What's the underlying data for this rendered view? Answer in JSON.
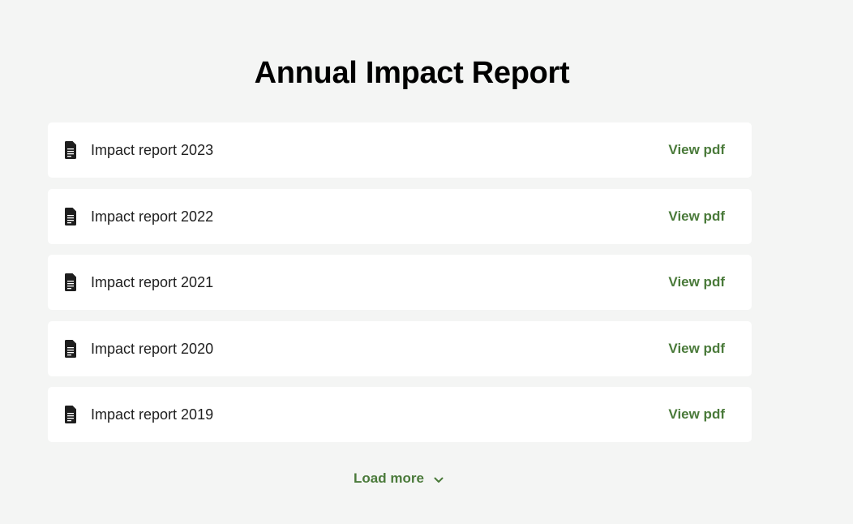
{
  "page": {
    "title": "Annual Impact Report"
  },
  "reports": [
    {
      "name": "Impact report 2023",
      "action_label": "View pdf",
      "icon": "document-icon"
    },
    {
      "name": "Impact report 2022",
      "action_label": "View pdf",
      "icon": "document-icon"
    },
    {
      "name": "Impact report 2021",
      "action_label": "View pdf",
      "icon": "document-icon"
    },
    {
      "name": "Impact report 2020",
      "action_label": "View pdf",
      "icon": "document-icon"
    },
    {
      "name": "Impact report 2019",
      "action_label": "View pdf",
      "icon": "document-icon"
    }
  ],
  "load_more": {
    "label": "Load more",
    "icon": "chevron-down-icon"
  },
  "colors": {
    "background": "#f4f5f4",
    "card": "#ffffff",
    "accent": "#4a7a3a",
    "text": "#1e1e1e"
  }
}
